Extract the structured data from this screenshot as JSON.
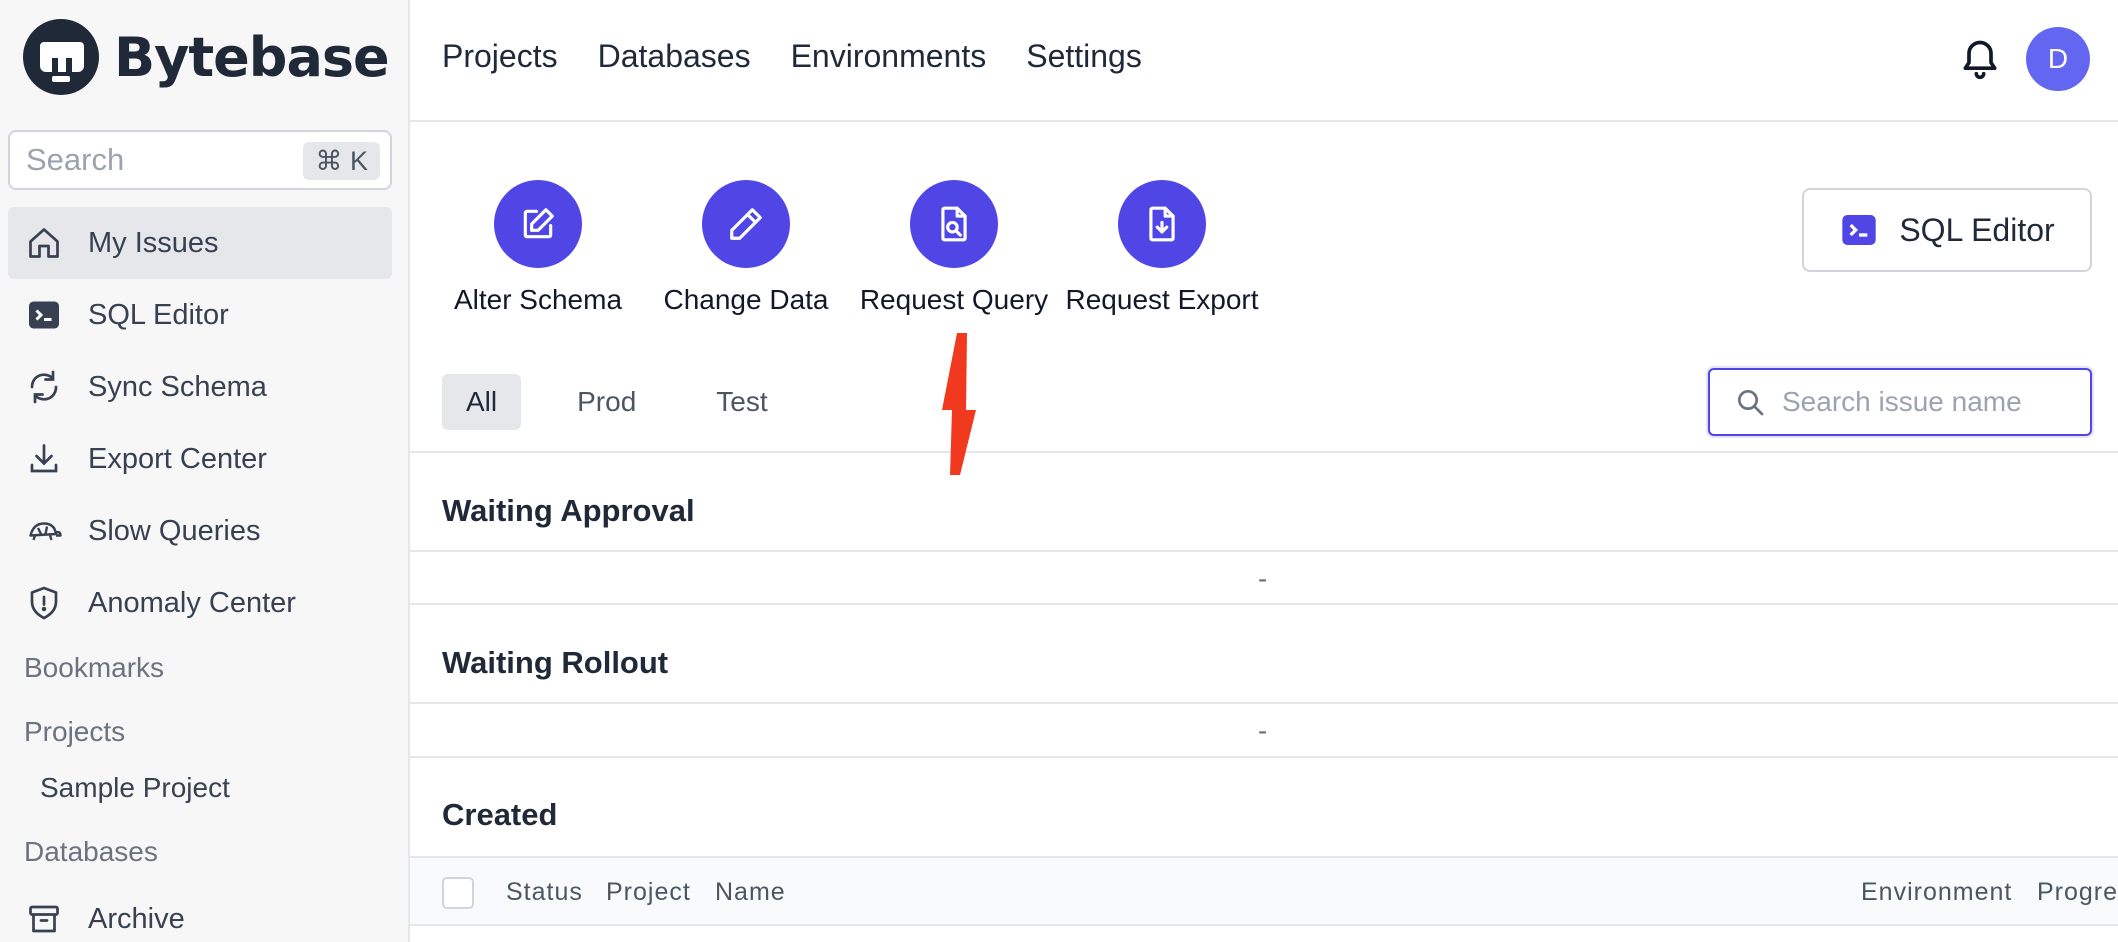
{
  "app": {
    "name": "Bytebase"
  },
  "colors": {
    "accent": "#4f46e5",
    "avatar": "#6366f1",
    "annotation_arrow": "#f0391f"
  },
  "sidebar": {
    "search": {
      "placeholder": "Search",
      "shortcut": "⌘ K"
    },
    "items": [
      {
        "label": "My Issues",
        "icon": "home-icon",
        "active": true
      },
      {
        "label": "SQL Editor",
        "icon": "terminal-icon"
      },
      {
        "label": "Sync Schema",
        "icon": "refresh-icon"
      },
      {
        "label": "Export Center",
        "icon": "download-icon"
      },
      {
        "label": "Slow Queries",
        "icon": "turtle-icon"
      },
      {
        "label": "Anomaly Center",
        "icon": "shield-icon"
      }
    ],
    "bookmarks_label": "Bookmarks",
    "projects_label": "Projects",
    "projects": [
      {
        "label": "Sample Project"
      }
    ],
    "databases_label": "Databases",
    "archive_label": "Archive"
  },
  "header": {
    "nav": [
      "Projects",
      "Databases",
      "Environments",
      "Settings"
    ],
    "avatar_initial": "D"
  },
  "quick_actions": [
    {
      "label": "Alter Schema",
      "icon": "edit-icon"
    },
    {
      "label": "Change Data",
      "icon": "pencil-icon"
    },
    {
      "label": "Request Query",
      "icon": "file-search-icon"
    },
    {
      "label": "Request Export",
      "icon": "file-download-icon"
    }
  ],
  "sql_editor_button": {
    "label": "SQL Editor"
  },
  "tabs": [
    "All",
    "Prod",
    "Test"
  ],
  "issue_search": {
    "placeholder": "Search issue name"
  },
  "sections": {
    "waiting_approval": {
      "title": "Waiting Approval",
      "empty": "-"
    },
    "waiting_rollout": {
      "title": "Waiting Rollout",
      "empty": "-"
    },
    "created": {
      "title": "Created"
    }
  },
  "table": {
    "columns": [
      "Status",
      "Project",
      "Name",
      "Environment",
      "Progre"
    ]
  }
}
